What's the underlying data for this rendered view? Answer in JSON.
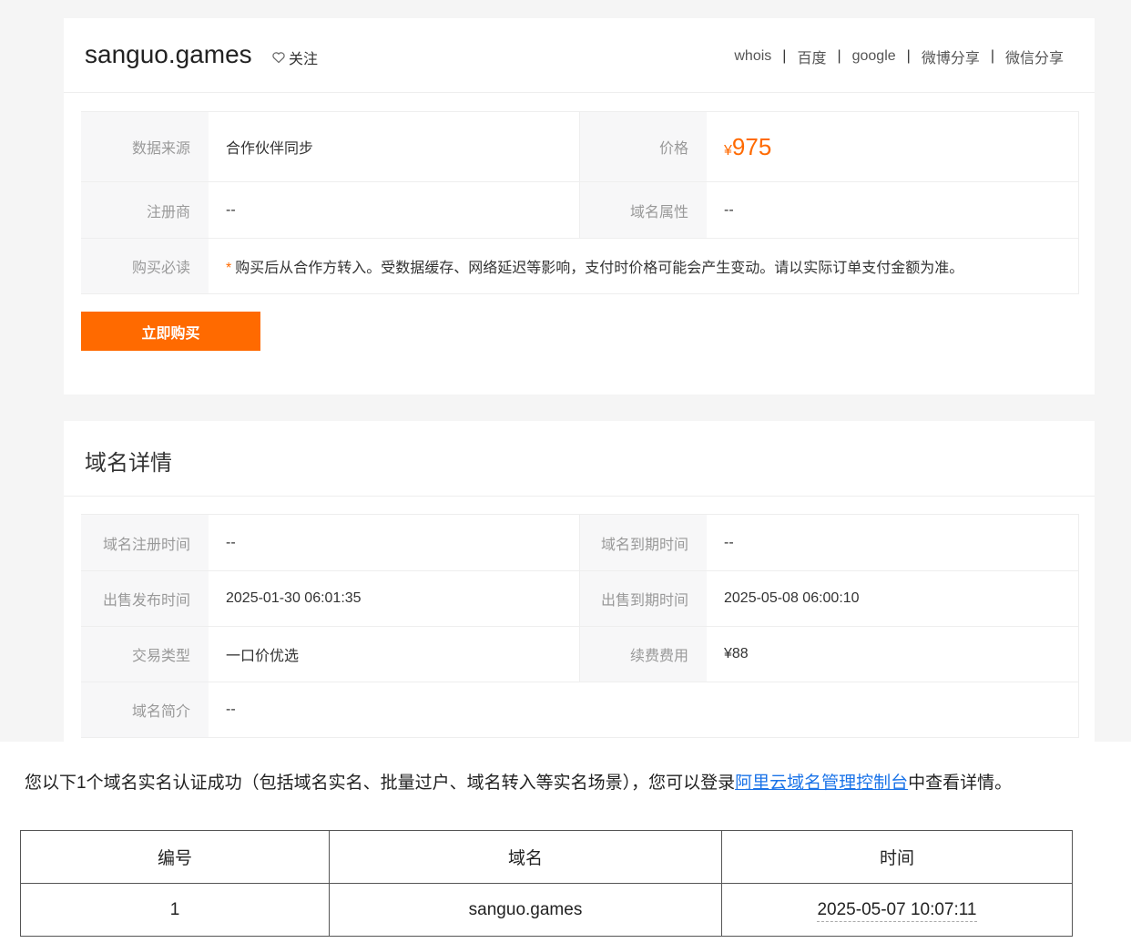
{
  "header": {
    "domain": "sanguo.games",
    "follow_label": "关注",
    "links": [
      "whois",
      "百度",
      "google",
      "微博分享",
      "微信分享"
    ]
  },
  "info": {
    "source_label": "数据来源",
    "source_value": "合作伙伴同步",
    "price_label": "价格",
    "price_currency": "¥",
    "price_value": "975",
    "registrar_label": "注册商",
    "registrar_value": "--",
    "attribute_label": "域名属性",
    "attribute_value": "--",
    "notice_label": "购买必读",
    "notice_star": "*",
    "notice_value": "购买后从合作方转入。受数据缓存、网络延迟等影响，支付时价格可能会产生变动。请以实际订单支付金额为准。"
  },
  "buy_button": "立即购买",
  "detail": {
    "title": "域名详情",
    "reg_time_label": "域名注册时间",
    "reg_time_value": "--",
    "expire_label": "域名到期时间",
    "expire_value": "--",
    "publish_label": "出售发布时间",
    "publish_value": "2025-01-30 06:01:35",
    "sale_expire_label": "出售到期时间",
    "sale_expire_value": "2025-05-08 06:00:10",
    "trade_type_label": "交易类型",
    "trade_type_value": "一口价优选",
    "renew_label": "续费费用",
    "renew_value": "¥88",
    "intro_label": "域名简介",
    "intro_value": "--"
  },
  "notice": {
    "prefix": "您以下1个域名实名认证成功（包括域名实名、批量过户、域名转入等实名场景），您可以登录",
    "link": "阿里云域名管理控制台",
    "suffix": "中查看详情。"
  },
  "result_table": {
    "headers": [
      "编号",
      "域名",
      "时间"
    ],
    "rows": [
      [
        "1",
        "sanguo.games",
        "2025-05-07 10:07:11"
      ]
    ]
  },
  "colors": {
    "accent": "#ff6a00",
    "link": "#1a73e8"
  }
}
